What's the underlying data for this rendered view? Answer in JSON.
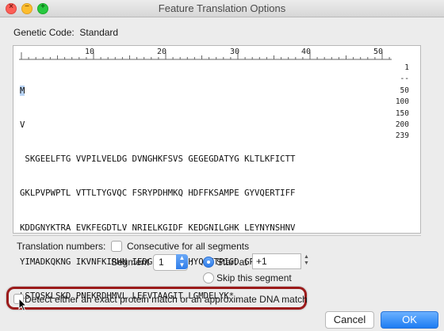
{
  "window": {
    "title": "Feature Translation Options",
    "traffic_lights": {
      "close": "×",
      "minimize": "–",
      "maximize": "+"
    }
  },
  "genetic_code": {
    "label": "Genetic Code:",
    "value": "Standard"
  },
  "ruler": {
    "marks": [
      "10",
      "20",
      "30",
      "40",
      "50"
    ]
  },
  "sequence": {
    "lines": [
      {
        "text": "M",
        "count": "1",
        "highlight": true
      },
      {
        "text": "V",
        "count": "--"
      },
      {
        "text": " SKGEELFTG VVPILVELDG DVNGHKFSVS GEGEGDATYG KLTLKFICTT",
        "count": "50"
      },
      {
        "text": "GKLPVPWPTL VTTLTYGVQC FSRYPDHMKQ HDFFKSAMPE GYVQERTIFF",
        "count": "100"
      },
      {
        "text": "KDDGNYKTRA EVKFEGDTLV NRIELKGIDF KEDGNILGHK LEYNYNSHNV",
        "count": "150"
      },
      {
        "text": "YIMADKQKNG IKVNFKIRHN IEDGSVQLAD HYQQNTPIGD GPVLLPDNHY",
        "count": "200"
      },
      {
        "text": "LSTQSKLSKD PNEKRDHMVL LEFVTAAGIT LGMDELYK*",
        "count": "239"
      }
    ]
  },
  "translation_numbers": {
    "label": "Translation numbers:",
    "consecutive_label": "Consecutive for all segments",
    "segment_label": "Segment",
    "segment_value": "1",
    "colon": ":",
    "start_at_label": "Start at",
    "start_at_value": "+1",
    "skip_label": "Skip this segment"
  },
  "detect_option": {
    "label": "Detect either an exact protein match or an approximate DNA match"
  },
  "buttons": {
    "cancel": "Cancel",
    "ok": "OK"
  },
  "colors": {
    "accent": "#2f7de9",
    "highlight_ring": "#9b1b1b",
    "selection": "#b8d3f4"
  },
  "icons": [
    "close-icon",
    "minimize-icon",
    "maximize-icon",
    "chevron-updown-icon",
    "stepper-icon",
    "mouse-pointer-icon"
  ]
}
